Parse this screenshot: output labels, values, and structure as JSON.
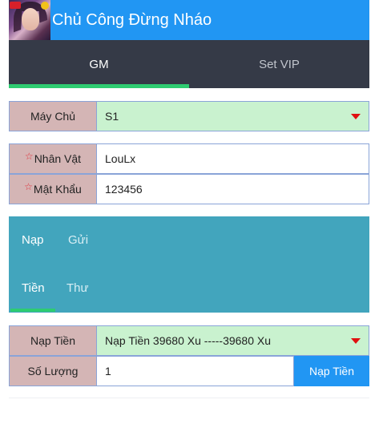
{
  "header": {
    "title": "Chủ Công Đừng Nháo"
  },
  "tabs": [
    {
      "label": "GM",
      "active": true
    },
    {
      "label": "Set VIP",
      "active": false
    }
  ],
  "server": {
    "label": "Máy Chủ",
    "value": "S1"
  },
  "character": {
    "label": "Nhân Vật",
    "value": "LouLx",
    "required_mark": "☆"
  },
  "password": {
    "label": "Mật Khẩu",
    "value": "123456",
    "required_mark": "☆"
  },
  "panel_tabs": [
    {
      "label": "Nạp",
      "active": true
    },
    {
      "label": "Gửi",
      "active": false
    },
    {
      "label": "Tiền",
      "active": true
    },
    {
      "label": "Thư",
      "active": false
    }
  ],
  "recharge": {
    "label": "Nạp Tiền",
    "value": "Nạp Tiền 39680 Xu -----39680 Xu"
  },
  "quantity": {
    "label": "Số Lượng",
    "value": "1",
    "button_label": "Nạp Tiền"
  },
  "colors": {
    "header_bg": "#2196f3",
    "tabs_bg": "#353a47",
    "active_underline": "#2ecc71",
    "label_bg": "#d4b5b5",
    "select_bg": "#c9f2cf",
    "panel_bg": "#42a5bd",
    "button_bg": "#2196f3"
  },
  "icons": {
    "avatar": "game-avatar",
    "dropdown": "red-triangle-down",
    "required": "star-outline"
  }
}
